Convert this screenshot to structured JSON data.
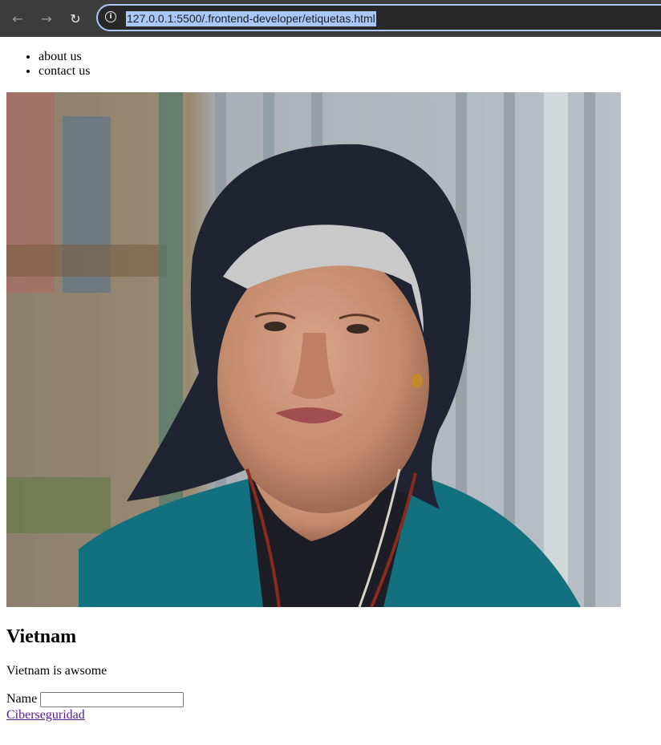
{
  "browser": {
    "url": "127.0.0.1:5500/.frontend-developer/etiquetas.html"
  },
  "nav": {
    "items": [
      "about us",
      "contact us"
    ]
  },
  "photo": {
    "alt": ""
  },
  "content": {
    "heading": "Vietnam",
    "description": "Vietnam is awsome"
  },
  "form": {
    "name_label": "Name",
    "name_value": "",
    "name_placeholder": ""
  },
  "link": {
    "text": "Ciberseguridad"
  }
}
